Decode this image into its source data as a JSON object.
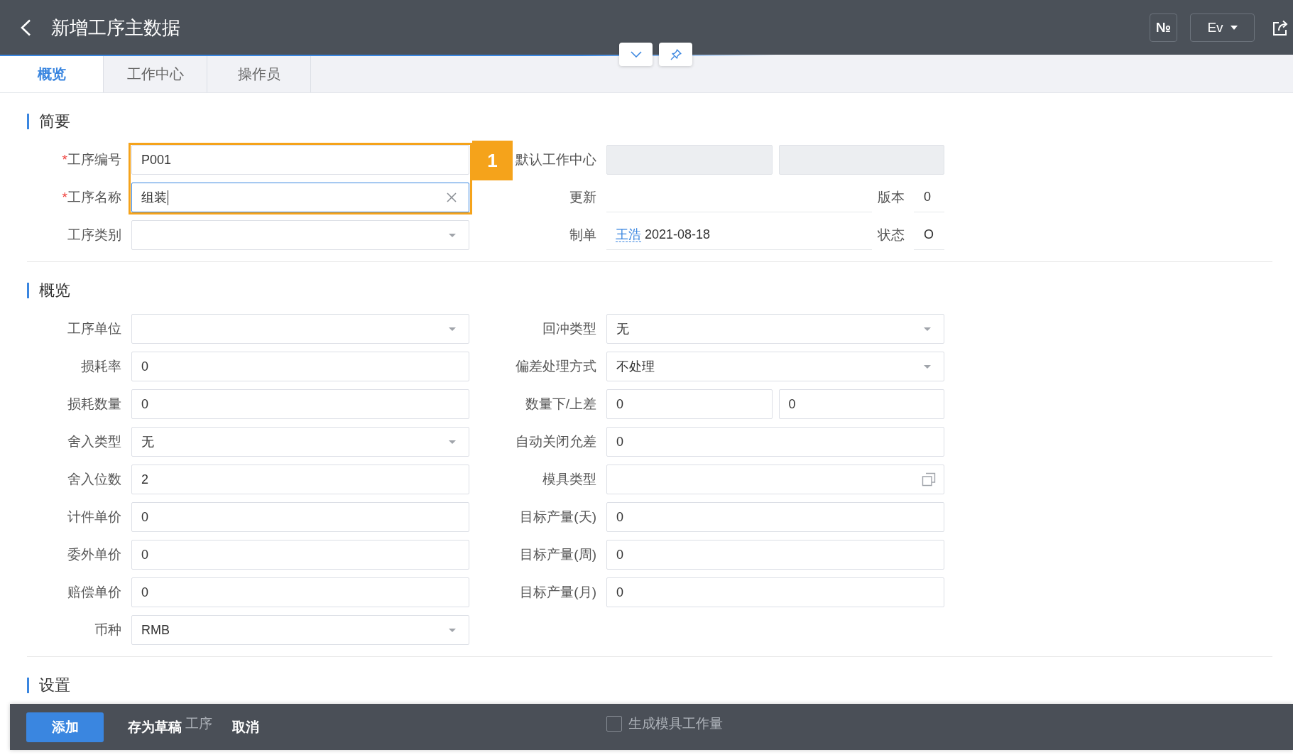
{
  "header": {
    "title": "新增工序主数据",
    "number_button": "№",
    "dropdown": "Ev"
  },
  "tabs": [
    {
      "label": "概览",
      "selected": true
    },
    {
      "label": "工作中心",
      "selected": false
    },
    {
      "label": "操作员",
      "selected": false
    }
  ],
  "sections": [
    {
      "title": "简要",
      "callout_badge": "1",
      "left": [
        {
          "kind": "input",
          "label": "工序编号",
          "required_mark": "*",
          "value": "P001",
          "focused": false,
          "highlighted": true
        },
        {
          "kind": "input",
          "label": "工序名称",
          "required_mark": "*",
          "value": "组装",
          "focused": true,
          "highlighted": true
        },
        {
          "kind": "select",
          "label": "工序类别",
          "highlighted": false
        }
      ],
      "right": [
        {
          "kind": "pair",
          "label": "默认工作中心",
          "disabled": true
        },
        {
          "kind": "info",
          "label": "更新",
          "side_label": "版本",
          "side_value": "0"
        },
        {
          "kind": "info",
          "label": "制单",
          "user": "王浩",
          "value": "2021-08-18",
          "side_label": "状态",
          "side_value": "O"
        }
      ]
    },
    {
      "title": "概览",
      "left": [
        {
          "kind": "select",
          "label": "工序单位"
        },
        {
          "kind": "input",
          "label": "损耗率",
          "value": "0",
          "focused": false
        },
        {
          "kind": "input",
          "label": "损耗数量",
          "value": "0",
          "focused": false
        },
        {
          "kind": "select",
          "label": "舍入类型",
          "value": "无"
        },
        {
          "kind": "input",
          "label": "舍入位数",
          "value": "2",
          "focused": false
        },
        {
          "kind": "input",
          "label": "计件单价",
          "value": "0",
          "focused": false
        },
        {
          "kind": "input",
          "label": "委外单价",
          "value": "0",
          "focused": false
        },
        {
          "kind": "input",
          "label": "赔偿单价",
          "value": "0",
          "focused": false
        },
        {
          "kind": "select",
          "label": "币种",
          "value": "RMB"
        }
      ],
      "right": [
        {
          "kind": "select",
          "label": "回冲类型",
          "value": "无"
        },
        {
          "kind": "select",
          "label": "偏差处理方式",
          "value": "不处理"
        },
        {
          "kind": "pair",
          "label": "数量下/上差",
          "disabled": false,
          "values": [
            "0",
            "0"
          ]
        },
        {
          "kind": "input",
          "label": "自动关闭允差",
          "value": "0",
          "focused": false
        },
        {
          "kind": "lookup",
          "label": "模具类型"
        },
        {
          "kind": "input",
          "label": "目标产量(天)",
          "value": "0",
          "focused": false
        },
        {
          "kind": "input",
          "label": "目标产量(周)",
          "value": "0",
          "focused": false
        },
        {
          "kind": "input",
          "label": "目标产量(月)",
          "value": "0",
          "focused": false
        }
      ]
    },
    {
      "title": "设置",
      "checkboxes": [
        {
          "label": "工序",
          "obscured": true
        },
        {
          "label": "生成模具工作量",
          "checked": false,
          "obscured": false
        }
      ]
    }
  ],
  "action_bar": [
    {
      "label": "添加",
      "kind": "primary"
    },
    {
      "label": "存为草稿",
      "kind": "text"
    },
    {
      "label": "取消",
      "kind": "text"
    }
  ]
}
